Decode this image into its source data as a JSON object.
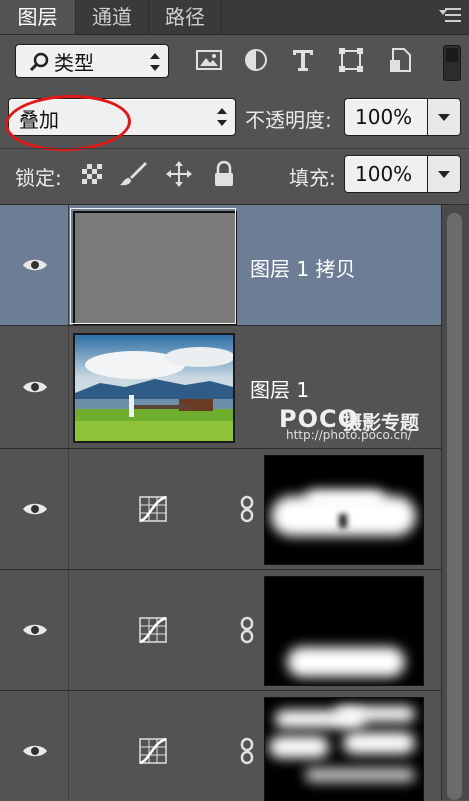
{
  "tabs": [
    {
      "label": "图层",
      "active": true
    },
    {
      "label": "通道",
      "active": false
    },
    {
      "label": "路径",
      "active": false
    }
  ],
  "filter": {
    "kind_label": "类型"
  },
  "blend": {
    "mode": "叠加",
    "opacity_label": "不透明度:",
    "opacity_value": "100%"
  },
  "lock": {
    "label": "锁定:",
    "fill_label": "填充:",
    "fill_value": "100%"
  },
  "layers": [
    {
      "name": "图层 1 拷贝",
      "visible": true,
      "selected": true,
      "thumb_color": "#7b7b7b"
    },
    {
      "name": "图层 1",
      "visible": true,
      "selected": false
    }
  ],
  "adjustment_layers": [
    {
      "type": "curves",
      "visible": true
    },
    {
      "type": "curves",
      "visible": true
    },
    {
      "type": "curves",
      "visible": true
    }
  ],
  "watermark": {
    "brand": "POCO",
    "text": "摄影专题",
    "url": "http://photo.poco.cn/"
  },
  "colors": {
    "panel": "#535353",
    "selected_row": "#6d7d96",
    "annotation": "#e01818"
  }
}
